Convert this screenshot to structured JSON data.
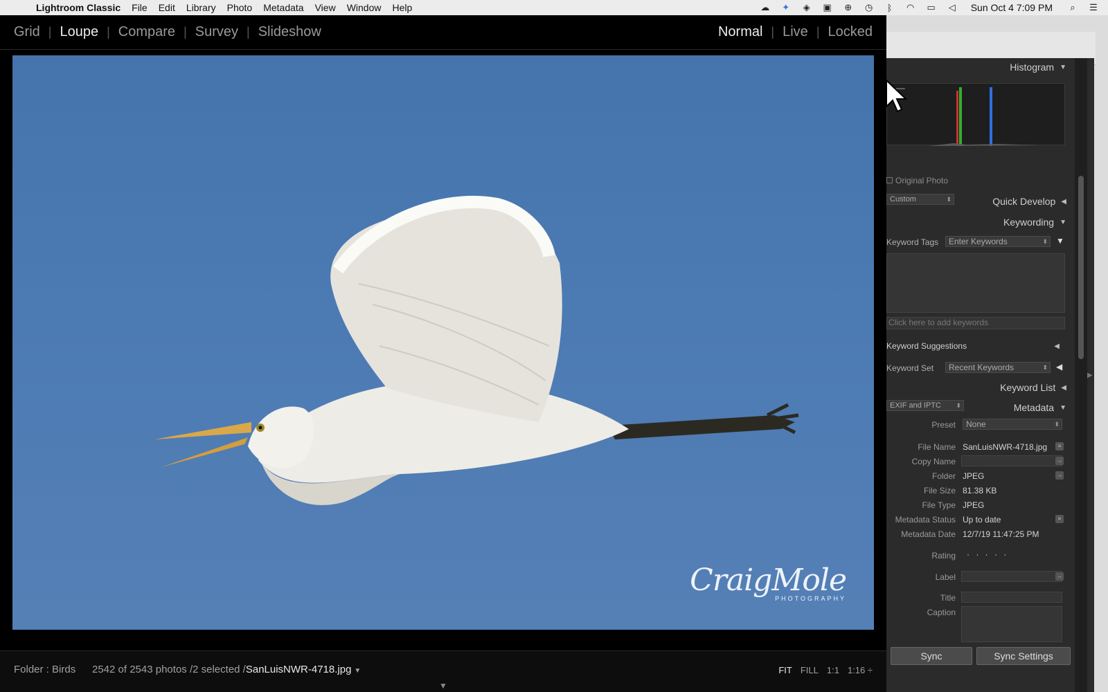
{
  "menubar": {
    "app": "Lightroom Classic",
    "items": [
      "File",
      "Edit",
      "Library",
      "Photo",
      "Metadata",
      "View",
      "Window",
      "Help"
    ],
    "clock": "Sun Oct 4  7:09 PM"
  },
  "modebar": {
    "views": [
      "Grid",
      "Loupe",
      "Compare",
      "Survey",
      "Slideshow"
    ],
    "active_view": "Loupe",
    "lock_modes": [
      "Normal",
      "Live",
      "Locked"
    ],
    "active_lock": "Normal"
  },
  "photo": {
    "watermark_signature": "CraigMole",
    "watermark_sub": "PHOTOGRAPHY",
    "sky_color": "#4a78b0"
  },
  "status": {
    "folder": "Folder : Birds",
    "count": "2542 of 2543 photos /2 selected /",
    "filename": "SanLuisNWR-4718.jpg",
    "zoom_options": [
      "FIT",
      "FILL",
      "1:1",
      "1:16 ÷"
    ],
    "active_zoom": "FIT"
  },
  "panel": {
    "histogram": "Histogram",
    "original_photo": "Original Photo",
    "saved_preset": "Custom",
    "quick_develop": "Quick Develop",
    "keywording": "Keywording",
    "keyword_tags_label": "Keyword Tags",
    "keyword_tags_value": "Enter Keywords",
    "add_keywords": "Click here to add keywords",
    "keyword_suggestions": "Keyword Suggestions",
    "keyword_set_label": "Keyword Set",
    "keyword_set_value": "Recent Keywords",
    "keyword_list": "Keyword List",
    "metadata_view": "EXIF and IPTC",
    "metadata": "Metadata",
    "preset_label": "Preset",
    "preset_value": "None",
    "fields": [
      {
        "label": "File Name",
        "value": "SanLuisNWR-4718.jpg"
      },
      {
        "label": "Copy Name",
        "value": ""
      },
      {
        "label": "Folder",
        "value": "JPEG"
      },
      {
        "label": "File Size",
        "value": "81.38 KB"
      },
      {
        "label": "File Type",
        "value": "JPEG"
      },
      {
        "label": "Metadata Status",
        "value": "Up to date"
      },
      {
        "label": "Metadata Date",
        "value": "12/7/19 11:47:25 PM"
      }
    ],
    "rating_label": "Rating",
    "rating_value": "· · · · ·",
    "label_label": "Label",
    "title_label": "Title",
    "caption_label": "Caption",
    "sync": "Sync",
    "sync_settings": "Sync Settings"
  }
}
